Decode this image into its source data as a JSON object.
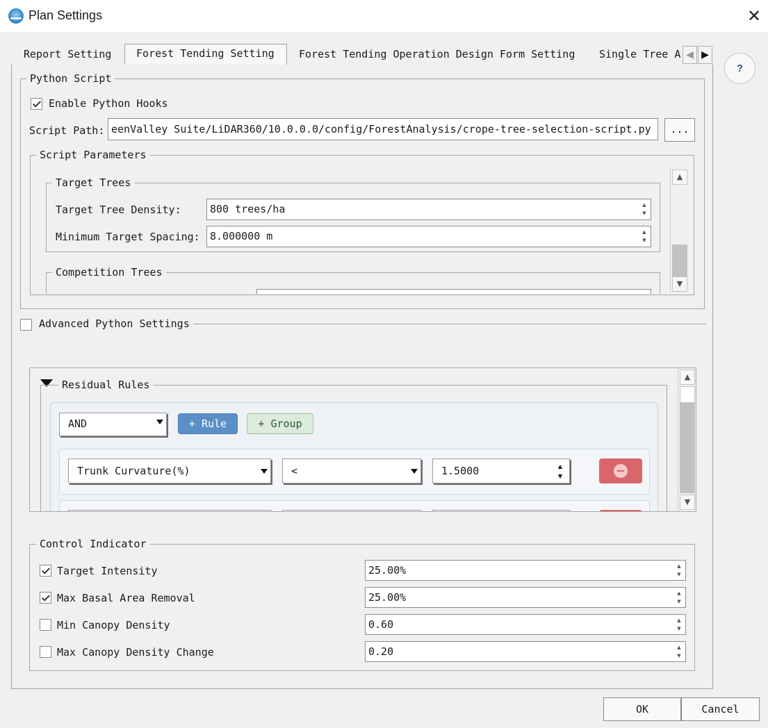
{
  "window": {
    "title": "Plan Settings",
    "close_glyph": "✕"
  },
  "tabs": [
    {
      "label": "Report Setting"
    },
    {
      "label": "Forest Tending Setting"
    },
    {
      "label": "Forest Tending Operation Design Form Setting"
    },
    {
      "label": "Single Tree A"
    }
  ],
  "tab_nav": {
    "prev_glyph": "◀",
    "next_glyph": "▶"
  },
  "help": {
    "label": "?"
  },
  "python_script": {
    "legend": "Python Script",
    "enable_hooks": {
      "label": "Enable Python Hooks",
      "checked": true
    },
    "script_path": {
      "label": "Script Path:",
      "value": "eenValley Suite/LiDAR360/10.0.0.0/config/ForestAnalysis/crope-tree-selection-script.py",
      "browse_label": "..."
    },
    "parameters": {
      "legend": "Script Parameters",
      "target_trees": {
        "legend": "Target Trees",
        "density": {
          "label": "Target Tree Density:",
          "value": "800 trees/ha"
        },
        "spacing": {
          "label": "Minimum Target Spacing:",
          "value": "8.000000 m"
        }
      },
      "competition_trees": {
        "legend": "Competition Trees"
      }
    }
  },
  "advanced": {
    "label": "Advanced Python Settings",
    "checked": false
  },
  "residual_rules": {
    "title": "Residual Rules",
    "logic": "AND",
    "add_rule_label": "+ Rule",
    "add_group_label": "+ Group",
    "rules": [
      {
        "field": "Trunk Curvature(%)",
        "operator": "<",
        "value": "1.5000"
      }
    ]
  },
  "control_indicator": {
    "legend": "Control Indicator",
    "items": [
      {
        "label": "Target Intensity",
        "checked": true,
        "value": "25.00%"
      },
      {
        "label": "Max Basal Area Removal",
        "checked": true,
        "value": "25.00%"
      },
      {
        "label": "Min Canopy Density",
        "checked": false,
        "value": "0.60"
      },
      {
        "label": "Max Canopy Density Change",
        "checked": false,
        "value": "0.20"
      }
    ]
  },
  "footer": {
    "ok_label": "OK",
    "cancel_label": "Cancel"
  },
  "colors": {
    "rule_button": "#5b8fc7",
    "group_button": "#dcebdc",
    "remove_button": "#d9666a"
  },
  "icons": {
    "collapse": "triangle-down-icon",
    "remove": "minus-circle-icon"
  }
}
